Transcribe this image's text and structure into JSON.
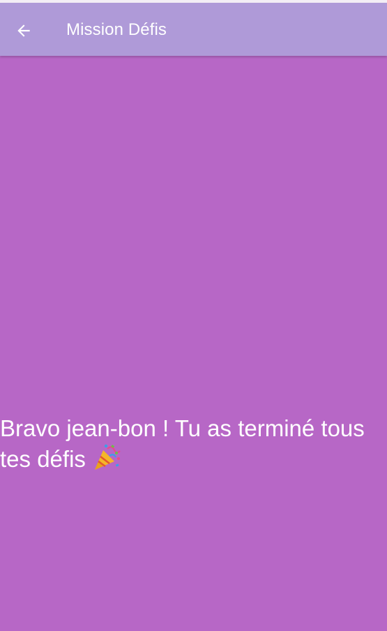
{
  "app_bar": {
    "title": "Mission Défis",
    "back_icon": "arrow-back-icon",
    "background": "#af9ad8"
  },
  "main": {
    "background": "#b767c6",
    "message_line1": "Bravo jean-bon ! Tu as terminé tous",
    "message_line2": "tes défis",
    "message_emoji_icon": "party-popper-icon"
  }
}
